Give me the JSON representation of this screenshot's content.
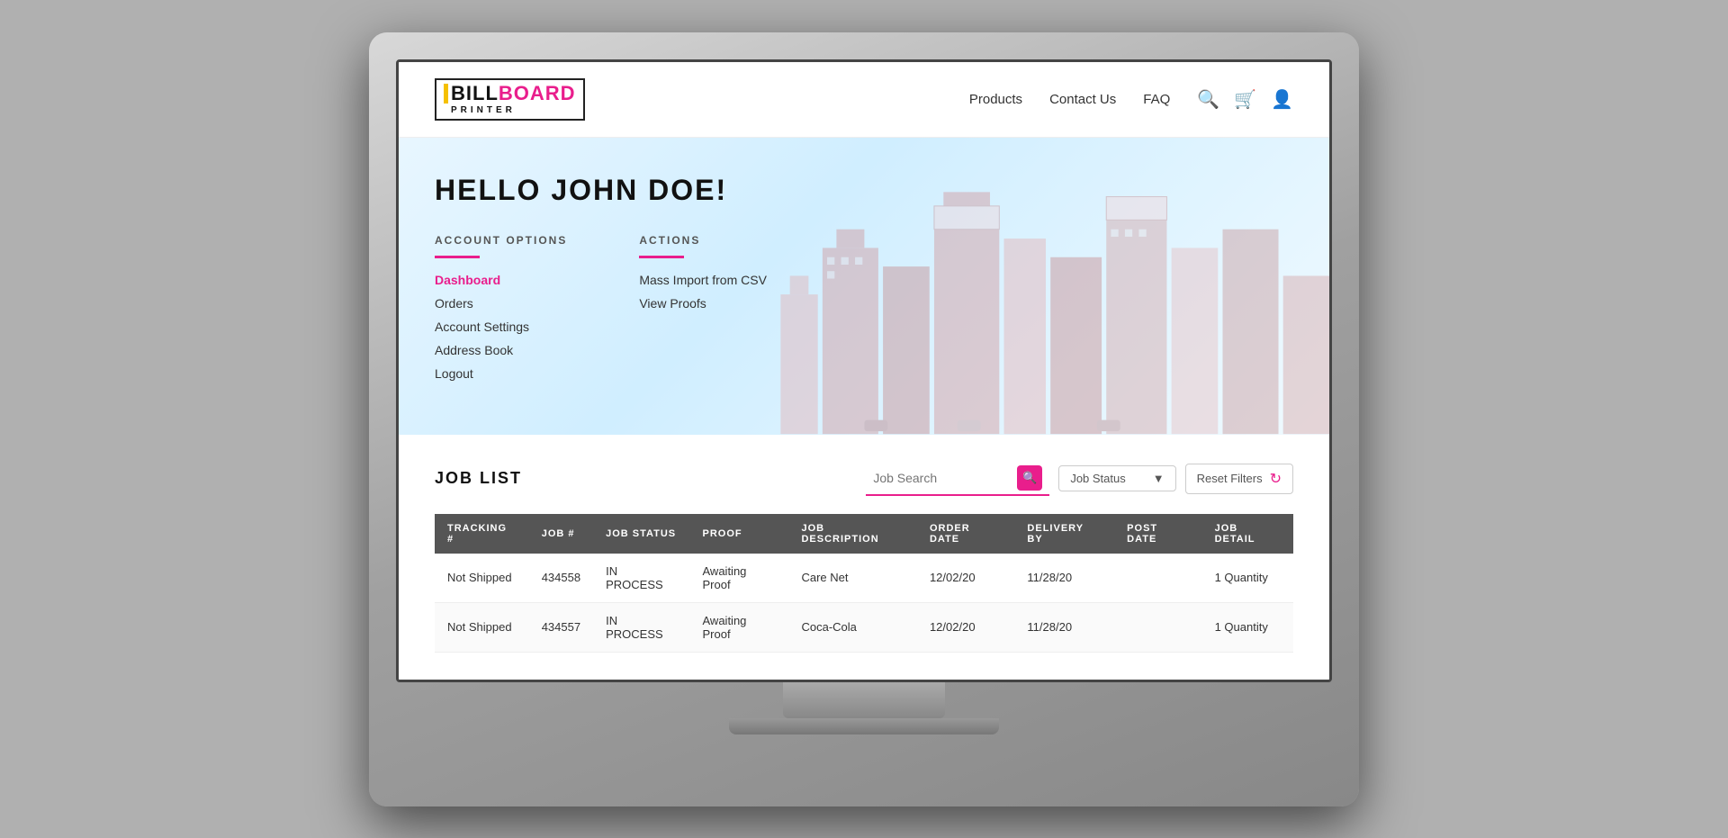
{
  "logo": {
    "bill": "BILL",
    "board": "BOARD",
    "printer": "PRINTER"
  },
  "nav": {
    "links": [
      "Products",
      "Contact Us",
      "FAQ"
    ],
    "icons": {
      "search": "🔍",
      "cart": "🛒",
      "user": "👤"
    }
  },
  "hero": {
    "greeting": "HELLO JOHN DOE!",
    "account_options_heading": "ACCOUNT OPTIONS",
    "actions_heading": "ACTIONS",
    "account_links": [
      {
        "label": "Dashboard",
        "active": true
      },
      {
        "label": "Orders",
        "active": false
      },
      {
        "label": "Account Settings",
        "active": false
      },
      {
        "label": "Address Book",
        "active": false
      },
      {
        "label": "Logout",
        "active": false
      }
    ],
    "action_links": [
      {
        "label": "Mass Import from CSV"
      },
      {
        "label": "View Proofs"
      }
    ]
  },
  "job_list": {
    "title": "JOB LIST",
    "search_placeholder": "Job Search",
    "status_filter_label": "Job Status",
    "reset_label": "Reset Filters",
    "table": {
      "headers": [
        "TRACKING #",
        "JOB #",
        "JOB STATUS",
        "PROOF",
        "JOB DESCRIPTION",
        "ORDER DATE",
        "DELIVERY BY",
        "POST DATE",
        "JOB DETAIL"
      ],
      "rows": [
        {
          "tracking": "Not Shipped",
          "job_num": "434558",
          "job_status": "IN PROCESS",
          "proof": "Awaiting Proof",
          "description": "Care Net",
          "order_date": "12/02/20",
          "delivery_by": "11/28/20",
          "post_date": "",
          "job_detail": "1 Quantity"
        },
        {
          "tracking": "Not Shipped",
          "job_num": "434557",
          "job_status": "IN PROCESS",
          "proof": "Awaiting Proof",
          "description": "Coca-Cola",
          "order_date": "12/02/20",
          "delivery_by": "11/28/20",
          "post_date": "",
          "job_detail": "1 Quantity"
        }
      ]
    }
  }
}
